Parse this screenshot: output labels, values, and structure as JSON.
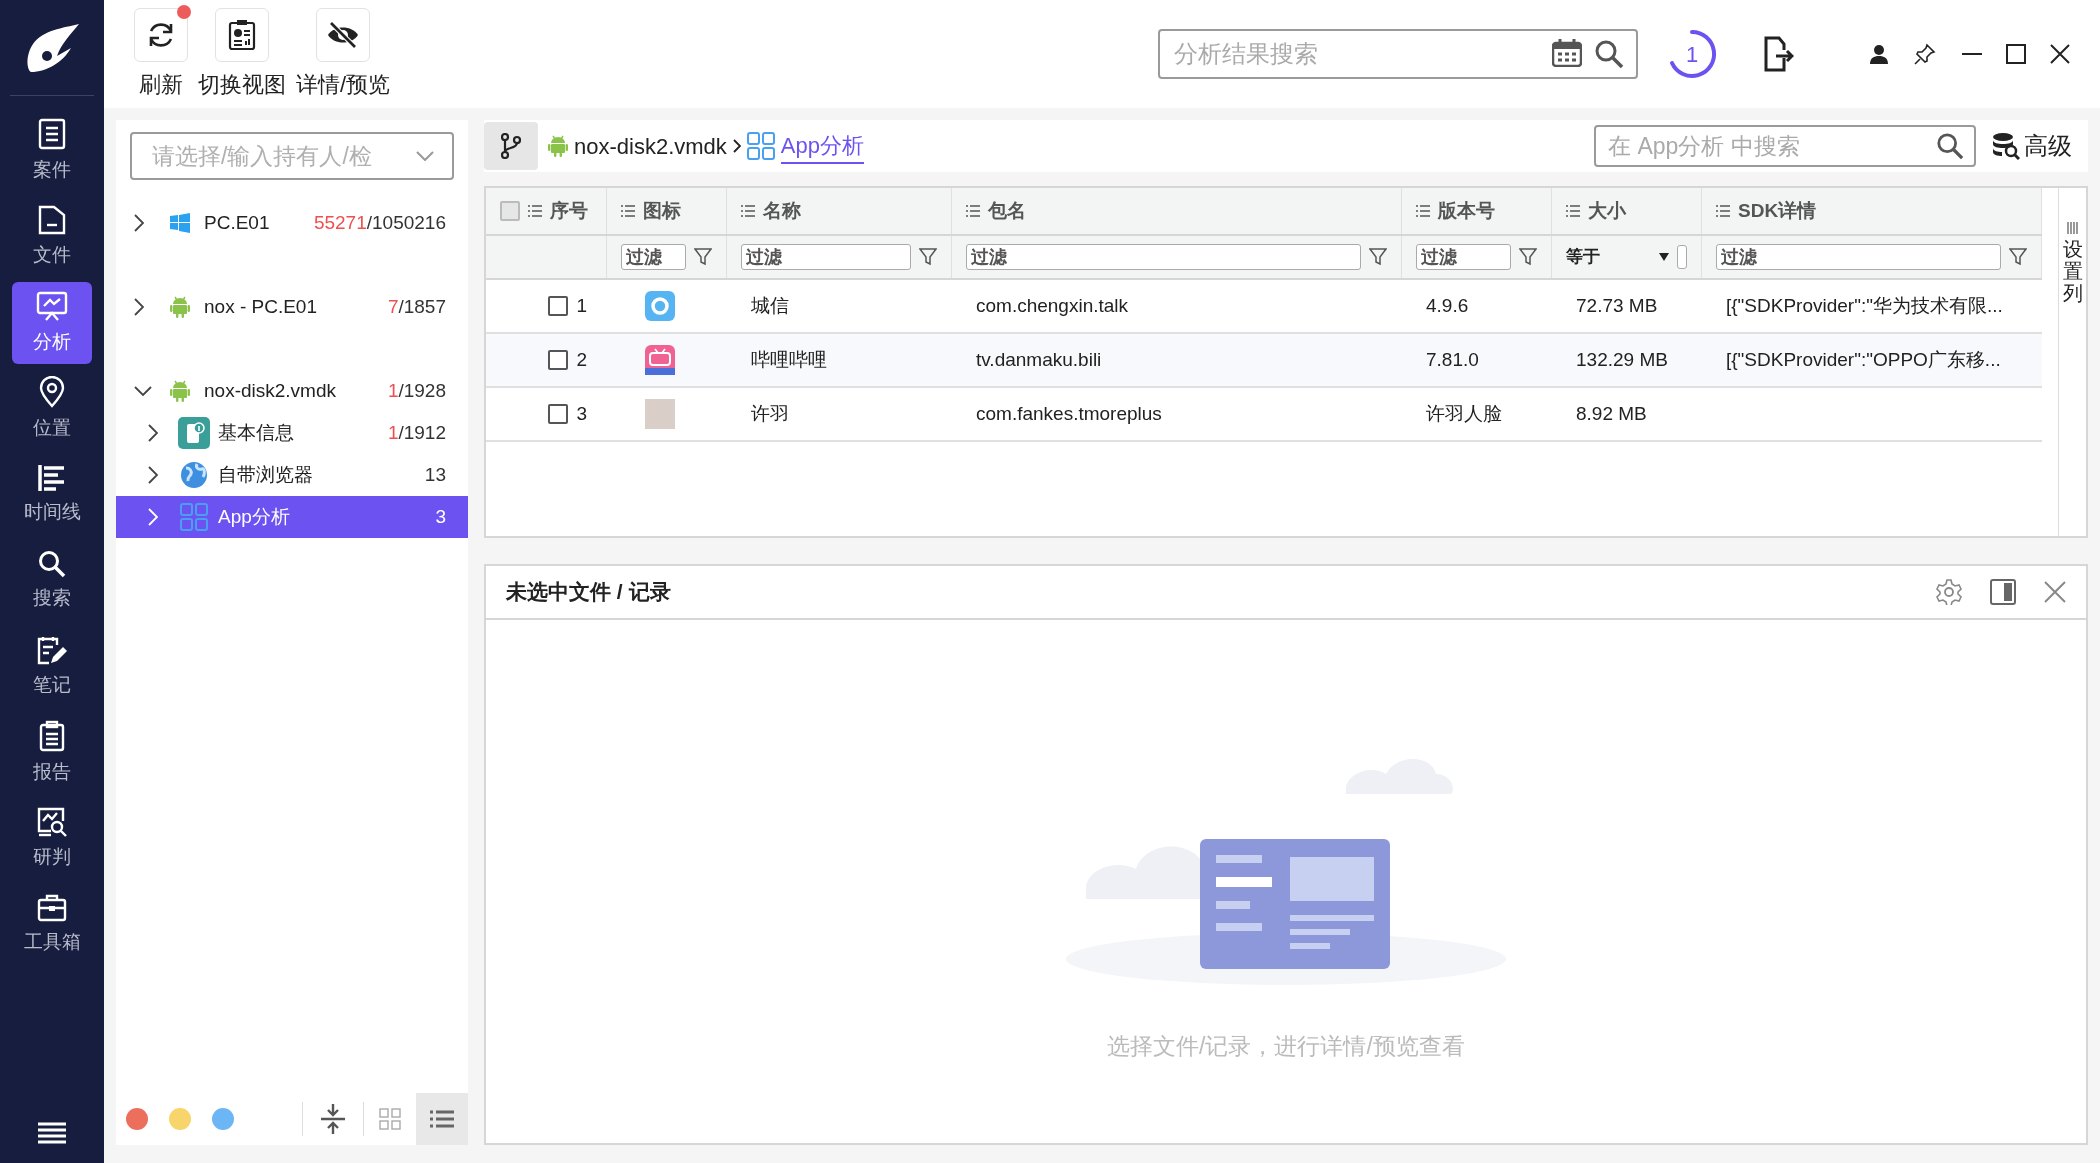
{
  "sidebar": {
    "items": [
      {
        "label": "案件",
        "selected": false
      },
      {
        "label": "文件",
        "selected": false
      },
      {
        "label": "分析",
        "selected": true
      },
      {
        "label": "位置",
        "selected": false
      },
      {
        "label": "时间线",
        "selected": false
      },
      {
        "label": "搜索",
        "selected": false
      },
      {
        "label": "笔记",
        "selected": false
      },
      {
        "label": "报告",
        "selected": false
      },
      {
        "label": "研判",
        "selected": false
      },
      {
        "label": "工具箱",
        "selected": false
      }
    ]
  },
  "toolbar": {
    "buttons": [
      {
        "label": "刷新",
        "badge": true
      },
      {
        "label": "切换视图",
        "badge": false
      },
      {
        "label": "详情/预览",
        "badge": false
      }
    ]
  },
  "search": {
    "placeholder": "分析结果搜索"
  },
  "task_counter": "1",
  "holder_select": {
    "placeholder": "请选择/输入持有人/检"
  },
  "tree": [
    {
      "kind": "windows",
      "label": "PC.E01",
      "hits": "55271",
      "total": "/1050216",
      "expanded": false,
      "selected": false
    },
    {
      "kind": "android",
      "label": "nox - PC.E01",
      "hits": "7",
      "total": "/1857",
      "expanded": false,
      "selected": false
    },
    {
      "kind": "android",
      "label": "nox-disk2.vmdk",
      "hits": "1",
      "total": "/1928",
      "expanded": true,
      "selected": false,
      "children": [
        {
          "kind": "info",
          "label": "基本信息",
          "hits": "1",
          "total": "/1912",
          "expanded": false,
          "selected": false
        },
        {
          "kind": "browser",
          "label": "自带浏览器",
          "total": "13",
          "expanded": false,
          "selected": false
        },
        {
          "kind": "apps",
          "label": "App分析",
          "total": "3",
          "expanded": false,
          "selected": true
        }
      ]
    }
  ],
  "breadcrumb": [
    {
      "kind": "android",
      "label": "nox-disk2.vmdk",
      "current": false
    },
    {
      "kind": "apps",
      "label": "App分析",
      "current": true
    }
  ],
  "table_search": {
    "placeholder": "在 App分析 中搜索"
  },
  "advanced_button": "高级",
  "table": {
    "all_checked": false,
    "columns": [
      {
        "label": "序号"
      },
      {
        "label": "图标",
        "filter": "过滤"
      },
      {
        "label": "名称",
        "filter": "过滤"
      },
      {
        "label": "包名",
        "filter": "过滤"
      },
      {
        "label": "版本号",
        "filter": "过滤"
      },
      {
        "label": "大小",
        "operator": "等于"
      },
      {
        "label": "SDK详情",
        "filter": "过滤"
      }
    ],
    "rows": [
      {
        "checked": false,
        "index": "1",
        "name": "城信",
        "package": "com.chengxin.talk",
        "version": "4.9.6",
        "size": "72.73 MB",
        "sdk": "[{\"SDKProvider\":\"华为技术有限..."
      },
      {
        "checked": false,
        "index": "2",
        "name": "哔哩哔哩",
        "package": "tv.danmaku.bili",
        "version": "7.81.0",
        "size": "132.29 MB",
        "sdk": "[{\"SDKProvider\":\"OPPO广东移..."
      },
      {
        "checked": false,
        "index": "3",
        "name": "许羽",
        "package": "com.fankes.tmoreplus",
        "version": "许羽人脸",
        "size": "8.92 MB"
      }
    ]
  },
  "column_settings": "设置列",
  "detail": {
    "title": "未选中文件 / 记录",
    "empty_text": "选择文件/记录，进行详情/预览查看"
  },
  "color_tags": [
    {
      "color": "#ec6f5d"
    },
    {
      "color": "#f7d56a"
    },
    {
      "color": "#6cb6f5"
    }
  ],
  "view_modes": [
    {
      "selected": false
    },
    {
      "selected": true
    }
  ]
}
